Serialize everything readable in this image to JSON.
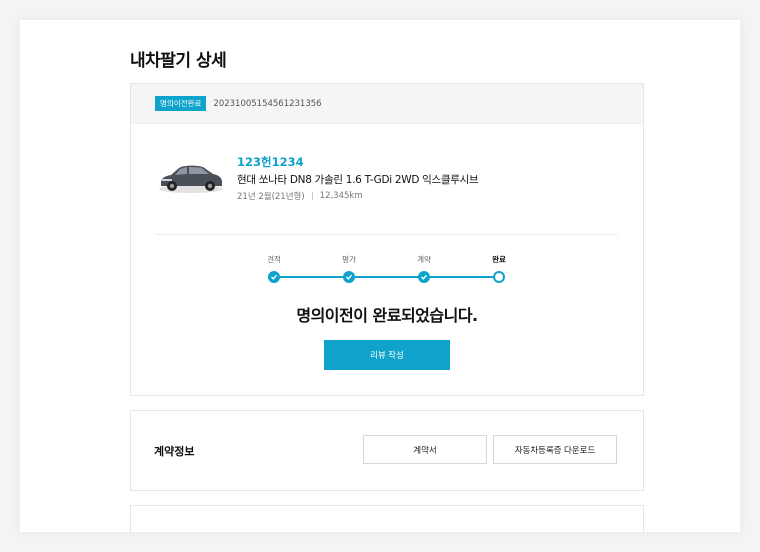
{
  "page": {
    "title": "내차팔기 상세"
  },
  "order": {
    "status_badge": "명의이전완료",
    "order_number": "20231005154561231356"
  },
  "car": {
    "plate": "123헌1234",
    "model": "현대 쏘나타 DN8 가솔린 1.6 T-GDi 2WD 익스클루시브",
    "registration": "21년 2월(21년형)",
    "mileage": "12,345km",
    "image_icon": "car-photo"
  },
  "progress": {
    "steps": [
      {
        "label": "견적",
        "state": "done"
      },
      {
        "label": "평가",
        "state": "done"
      },
      {
        "label": "계약",
        "state": "done"
      },
      {
        "label": "완료",
        "state": "current"
      }
    ],
    "message": "명의이전이 완료되었습니다.",
    "review_button": "리뷰 작성"
  },
  "contract": {
    "title": "계약정보",
    "contract_button": "계약서",
    "download_button": "자동차등록증 다운로드"
  },
  "colors": {
    "accent": "#0fa3cc"
  }
}
